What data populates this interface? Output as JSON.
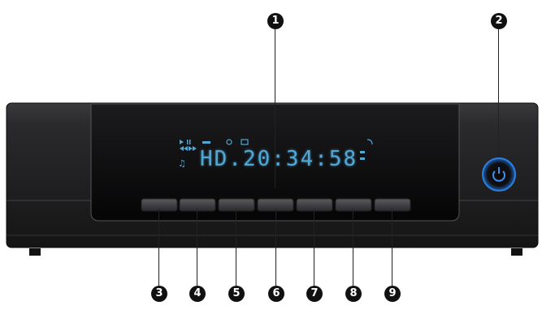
{
  "display": {
    "readout": "HD.20:34:58",
    "icons": [
      "play-icon",
      "pause-icon",
      "rewind-icon",
      "fast-forward-icon",
      "usb-icon",
      "music-note-icon",
      "disc-icon",
      "movie-icon",
      "network-icon",
      "hdmi-icon"
    ]
  },
  "callouts": {
    "c1": "1",
    "c2": "2",
    "c3": "3",
    "c4": "4",
    "c5": "5",
    "c6": "6",
    "c7": "7",
    "c8": "8",
    "c9": "9"
  },
  "colors": {
    "vfd": "#4fa8d6",
    "power_ring": "#2a7fe0",
    "body": "#1b1b1d"
  }
}
